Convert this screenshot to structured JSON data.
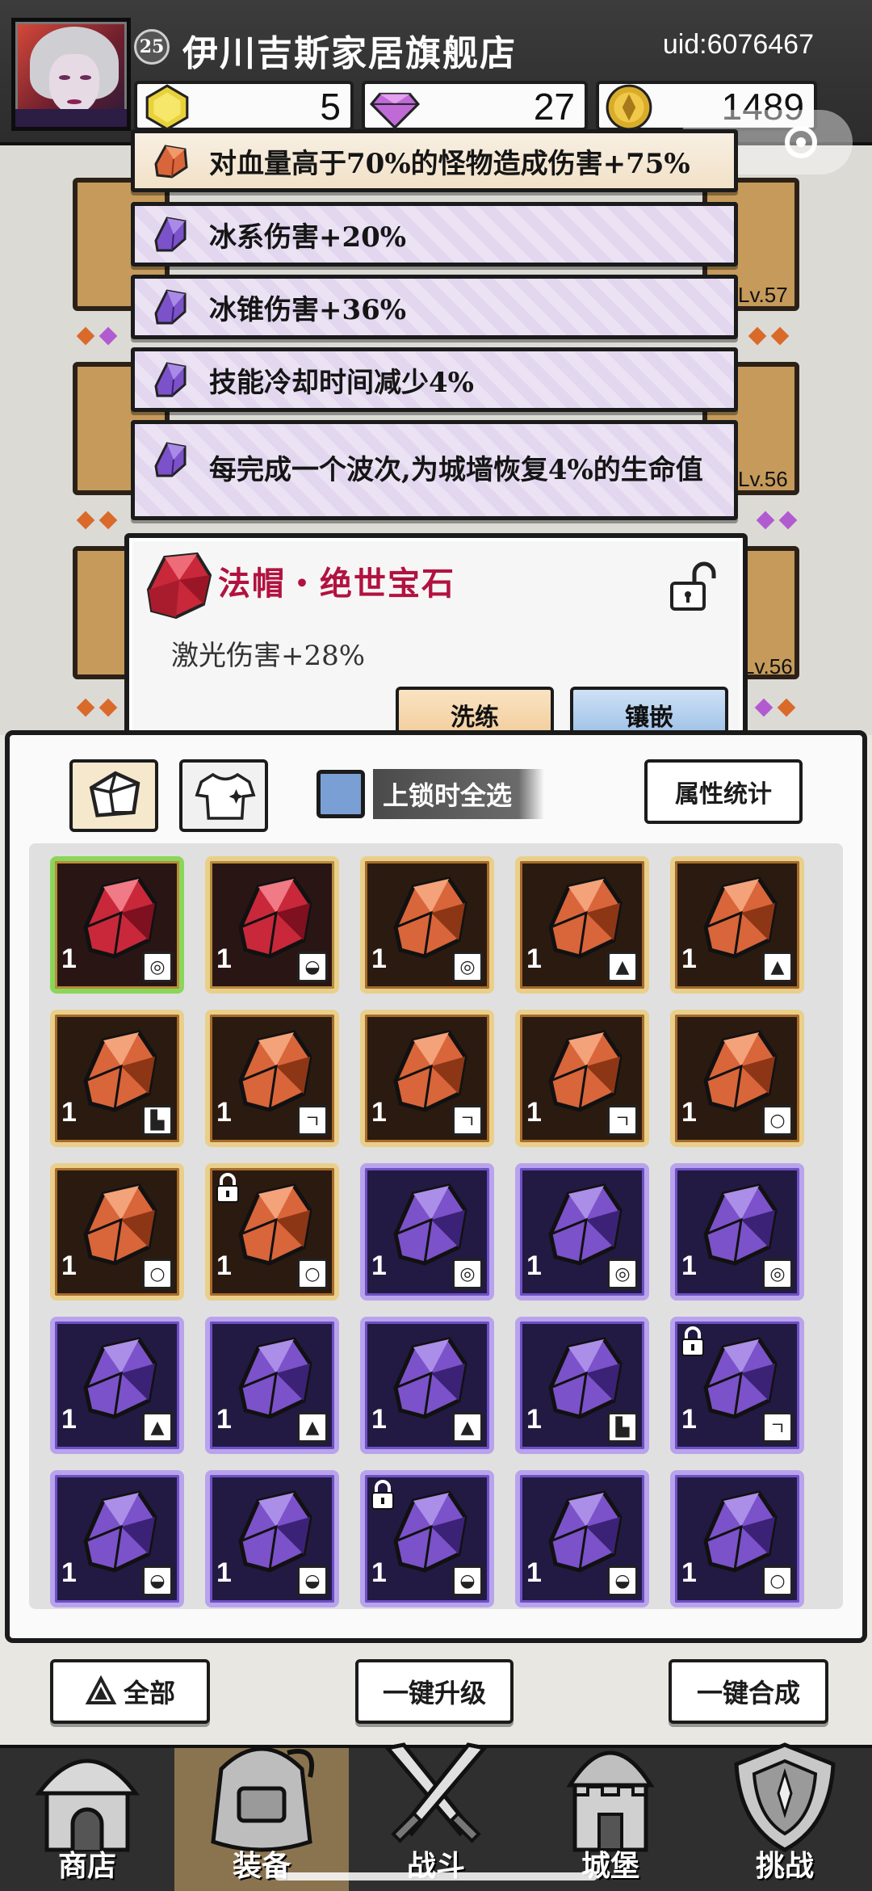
{
  "header": {
    "level": "25",
    "shop_name": "伊川吉斯家居旗舰店",
    "uid": "uid:6076467",
    "currencies": {
      "gold_gem": "5",
      "diamond": "27",
      "coin": "1489"
    }
  },
  "equipment": {
    "slot_levels": [
      "Lv.57",
      "Lv.56",
      "Lv.56"
    ]
  },
  "stats": [
    {
      "text": "对血量高于70%的怪物造成伤害+75%",
      "rarity": "orange"
    },
    {
      "text": "冰系伤害+20%",
      "rarity": "purple"
    },
    {
      "text": "冰锥伤害+36%",
      "rarity": "purple"
    },
    {
      "text": "技能冷却时间减少4%",
      "rarity": "purple"
    },
    {
      "text": "每完成一个波次,为城墙恢复4%的生命值",
      "rarity": "purple"
    }
  ],
  "popup": {
    "title": "法帽・绝世宝石",
    "description": "激光伤害+28%",
    "refine_label": "洗练",
    "inlay_label": "镶嵌"
  },
  "inventory": {
    "lock_select_label": "上锁时全选",
    "stats_button": "属性统计",
    "items": [
      {
        "rarity": "red",
        "qty": "1",
        "type": "hat",
        "selected": true,
        "locked": false
      },
      {
        "rarity": "red",
        "qty": "1",
        "type": "cap",
        "selected": false,
        "locked": false
      },
      {
        "rarity": "orange",
        "qty": "1",
        "type": "hat",
        "selected": false,
        "locked": false
      },
      {
        "rarity": "orange",
        "qty": "1",
        "type": "armor",
        "selected": false,
        "locked": false
      },
      {
        "rarity": "orange",
        "qty": "1",
        "type": "armor",
        "selected": false,
        "locked": false
      },
      {
        "rarity": "orange",
        "qty": "1",
        "type": "boots",
        "selected": false,
        "locked": false
      },
      {
        "rarity": "orange",
        "qty": "1",
        "type": "staff",
        "selected": false,
        "locked": false
      },
      {
        "rarity": "orange",
        "qty": "1",
        "type": "staff",
        "selected": false,
        "locked": false
      },
      {
        "rarity": "orange",
        "qty": "1",
        "type": "staff",
        "selected": false,
        "locked": false
      },
      {
        "rarity": "orange",
        "qty": "1",
        "type": "ring",
        "selected": false,
        "locked": false
      },
      {
        "rarity": "orange",
        "qty": "1",
        "type": "ring",
        "selected": false,
        "locked": false
      },
      {
        "rarity": "orange",
        "qty": "1",
        "type": "ring",
        "selected": false,
        "locked": true
      },
      {
        "rarity": "purple",
        "qty": "1",
        "type": "hat",
        "selected": false,
        "locked": false
      },
      {
        "rarity": "purple",
        "qty": "1",
        "type": "hat",
        "selected": false,
        "locked": false
      },
      {
        "rarity": "purple",
        "qty": "1",
        "type": "hat",
        "selected": false,
        "locked": false
      },
      {
        "rarity": "purple",
        "qty": "1",
        "type": "armor",
        "selected": false,
        "locked": false
      },
      {
        "rarity": "purple",
        "qty": "1",
        "type": "armor",
        "selected": false,
        "locked": false
      },
      {
        "rarity": "purple",
        "qty": "1",
        "type": "armor",
        "selected": false,
        "locked": false
      },
      {
        "rarity": "purple",
        "qty": "1",
        "type": "boots",
        "selected": false,
        "locked": false
      },
      {
        "rarity": "purple",
        "qty": "1",
        "type": "staff",
        "selected": false,
        "locked": true
      },
      {
        "rarity": "purple",
        "qty": "1",
        "type": "cap",
        "selected": false,
        "locked": false
      },
      {
        "rarity": "purple",
        "qty": "1",
        "type": "cap",
        "selected": false,
        "locked": false
      },
      {
        "rarity": "purple",
        "qty": "1",
        "type": "cap",
        "selected": false,
        "locked": true
      },
      {
        "rarity": "purple",
        "qty": "1",
        "type": "cap",
        "selected": false,
        "locked": false
      },
      {
        "rarity": "purple",
        "qty": "1",
        "type": "ring",
        "selected": false,
        "locked": false
      }
    ]
  },
  "actions": {
    "all_label": "全部",
    "upgrade_label": "一键升级",
    "merge_label": "一键合成"
  },
  "nav": [
    {
      "label": "商店",
      "icon": "shop-icon"
    },
    {
      "label": "装备",
      "icon": "backpack-icon"
    },
    {
      "label": "战斗",
      "icon": "crossed-swords-icon"
    },
    {
      "label": "城堡",
      "icon": "castle-icon"
    },
    {
      "label": "挑战",
      "icon": "shield-icon"
    }
  ],
  "colors": {
    "red_gem": "#c8283a",
    "orange_gem": "#d9653a",
    "purple_gem": "#7b52c9",
    "popup_title": "#b2123f"
  }
}
